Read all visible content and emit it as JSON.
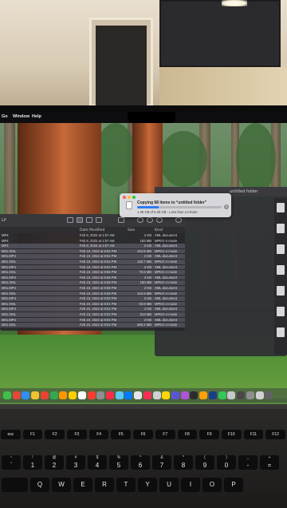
{
  "menubar": {
    "items": [
      "Go",
      "Window",
      "Help"
    ]
  },
  "copy_dialog": {
    "title": "Copying 68 items to “untitled folder”",
    "status": "1.38 GB of 5.49 GB - Less than a minute",
    "progress": 0.25,
    "accent": "#2f7bf6"
  },
  "window2": {
    "title": "untitled folder"
  },
  "finder": {
    "partial_label": "LP",
    "columns": {
      "date": "Date Modified",
      "size": "Size",
      "kind": "Kind"
    },
    "rows": [
      {
        "name": "MP4",
        "date": "Feb 8, 2022 at 1:57 AM",
        "size": "2 KB",
        "kind": "XML document"
      },
      {
        "name": "MP4",
        "date": "Feb 8, 2022 at 1:57 AM",
        "size": "183 MB",
        "kind": "MPEG-4 movie"
      },
      {
        "name": "MP4",
        "date": "Feb 8, 2022 at 1:57 AM",
        "size": "2 KB",
        "kind": "XML document"
      },
      {
        "name": "M01.XML",
        "date": "Feb 10, 2022 at 8:52 PM",
        "size": "344.9 MB",
        "kind": "MPEG-4 movie"
      },
      {
        "name": "M01.MP4",
        "date": "Feb 10, 2022 at 8:52 PM",
        "size": "2 KB",
        "kind": "XML document"
      },
      {
        "name": "M01.XML",
        "date": "Feb 10, 2022 at 8:54 PM",
        "size": "120.7 MB",
        "kind": "MPEG-4 movie"
      },
      {
        "name": "M01.MP4",
        "date": "Feb 10, 2022 at 8:54 PM",
        "size": "2 KB",
        "kind": "XML document"
      },
      {
        "name": "M01.XML",
        "date": "Feb 10, 2022 at 8:55 PM",
        "size": "75.5 MB",
        "kind": "MPEG-4 movie"
      },
      {
        "name": "M01.MP4",
        "date": "Feb 10, 2022 at 8:56 PM",
        "size": "2 KB",
        "kind": "XML document"
      },
      {
        "name": "M01.XML",
        "date": "Feb 10, 2022 at 8:56 PM",
        "size": "180 MB",
        "kind": "MPEG-4 movie"
      },
      {
        "name": "M01.MP4",
        "date": "Feb 10, 2022 at 8:58 PM",
        "size": "2 KB",
        "kind": "XML document"
      },
      {
        "name": "M01.XML",
        "date": "Feb 10, 2022 at 8:59 PM",
        "size": "104.9 MB",
        "kind": "MPEG-4 movie"
      },
      {
        "name": "M01.MP4",
        "date": "Feb 10, 2022 at 9:00 PM",
        "size": "2 KB",
        "kind": "XML document"
      },
      {
        "name": "M01.XML",
        "date": "Feb 10, 2022 at 9:01 PM",
        "size": "93.8 MB",
        "kind": "MPEG-4 movie"
      },
      {
        "name": "M01.MP4",
        "date": "Feb 10, 2022 at 9:01 PM",
        "size": "2 KB",
        "kind": "XML document"
      },
      {
        "name": "M01.XML",
        "date": "Feb 10, 2022 at 9:02 PM",
        "size": "513 MB",
        "kind": "MPEG-4 movie"
      },
      {
        "name": "M01.MP4",
        "date": "Feb 10, 2022 at 9:03 PM",
        "size": "2 KB",
        "kind": "XML document"
      },
      {
        "name": "M01.XML",
        "date": "Feb 10, 2022 at 9:04 PM",
        "size": "580.2 MB",
        "kind": "MPEG-4 movie"
      }
    ]
  },
  "dock_colors": [
    "#3fbf4a",
    "#e3473b",
    "#2f8df6",
    "#f1c232",
    "#ea4335",
    "#34a853",
    "#ff9500",
    "#ffcc00",
    "#ffffff",
    "#ff3b30",
    "#8e8e93",
    "#fa2d48",
    "#5ac8fa",
    "#007aff",
    "#e5e5ea",
    "#ff2d55",
    "#d0d0d4",
    "#ffd60a",
    "#5856d6",
    "#af52de",
    "#2c2c2e",
    "#ff9f0a",
    "#1c3c8c",
    "#34c759",
    "#c7c7cc",
    "#48484a",
    "#8e8e93",
    "#d1d1d6",
    "#636366"
  ],
  "keyboard": {
    "fn_row": [
      "esc",
      "F1",
      "F2",
      "F3",
      "F4",
      "F5",
      "F6",
      "F7",
      "F8",
      "F9",
      "F10",
      "F11",
      "F12"
    ],
    "num_row": [
      {
        "sym": "~",
        "main": "`"
      },
      {
        "sym": "!",
        "main": "1"
      },
      {
        "sym": "@",
        "main": "2"
      },
      {
        "sym": "#",
        "main": "3"
      },
      {
        "sym": "$",
        "main": "4"
      },
      {
        "sym": "%",
        "main": "5"
      },
      {
        "sym": "^",
        "main": "6"
      },
      {
        "sym": "&",
        "main": "7"
      },
      {
        "sym": "*",
        "main": "8"
      },
      {
        "sym": "(",
        "main": "9"
      },
      {
        "sym": ")",
        "main": "0"
      },
      {
        "sym": "_",
        "main": "-"
      },
      {
        "sym": "+",
        "main": "="
      }
    ],
    "letter_row": [
      "Q",
      "W",
      "E",
      "R",
      "T",
      "Y",
      "U",
      "I",
      "O",
      "P"
    ]
  }
}
